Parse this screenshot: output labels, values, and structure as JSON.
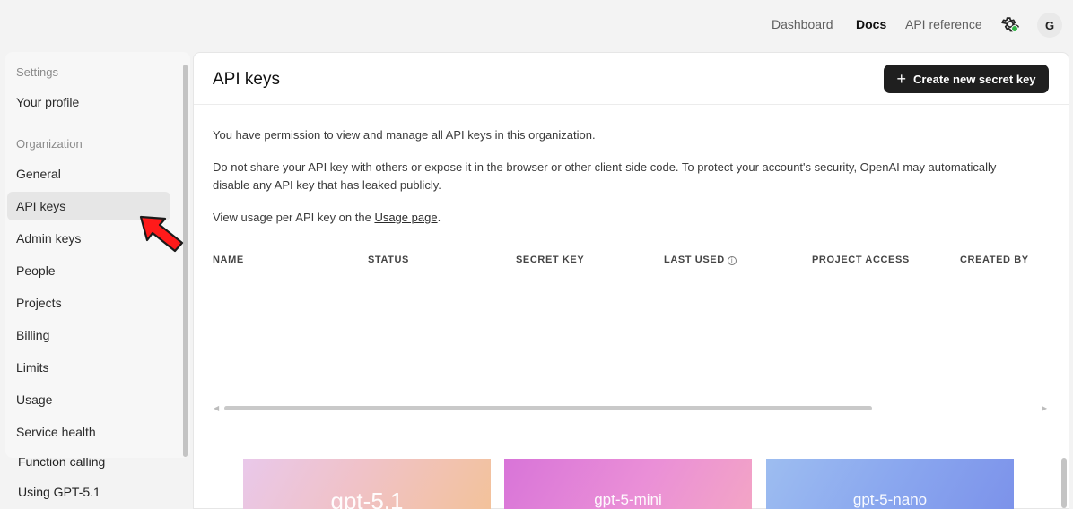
{
  "topnav": {
    "dashboard": "Dashboard",
    "docs": "Docs",
    "api_reference": "API reference",
    "avatar_initial": "G",
    "settings_icon": "gear-icon",
    "status_color": "#2fb344"
  },
  "sidebar": {
    "settings_section": "Settings",
    "your_profile": "Your profile",
    "organization_section": "Organization",
    "items": [
      {
        "label": "General"
      },
      {
        "label": "API keys",
        "active": true
      },
      {
        "label": "Admin keys"
      },
      {
        "label": "People"
      },
      {
        "label": "Projects"
      },
      {
        "label": "Billing"
      },
      {
        "label": "Limits"
      },
      {
        "label": "Usage"
      },
      {
        "label": "Service health"
      }
    ]
  },
  "background_docs": {
    "function_calling": "Function calling",
    "using_gpt": "Using GPT-5.1"
  },
  "main": {
    "title": "API keys",
    "create_button": "Create new secret key",
    "para1": "You have permission to view and manage all API keys in this organization.",
    "para2": "Do not share your API key with others or expose it in the browser or other client-side code. To protect your account's security, OpenAI may automatically disable any API key that has leaked publicly.",
    "para3_prefix": "View usage per API key on the ",
    "para3_link": "Usage page",
    "para3_suffix": ".",
    "table_headers": [
      "NAME",
      "STATUS",
      "SECRET KEY",
      "LAST USED",
      "PROJECT ACCESS",
      "CREATED BY"
    ]
  },
  "model_cards": [
    {
      "label": "gpt-5.1"
    },
    {
      "label": "gpt-5-mini"
    },
    {
      "label": "gpt-5-nano"
    }
  ],
  "annotation": {
    "arrow_color": "#ff1a1a"
  }
}
